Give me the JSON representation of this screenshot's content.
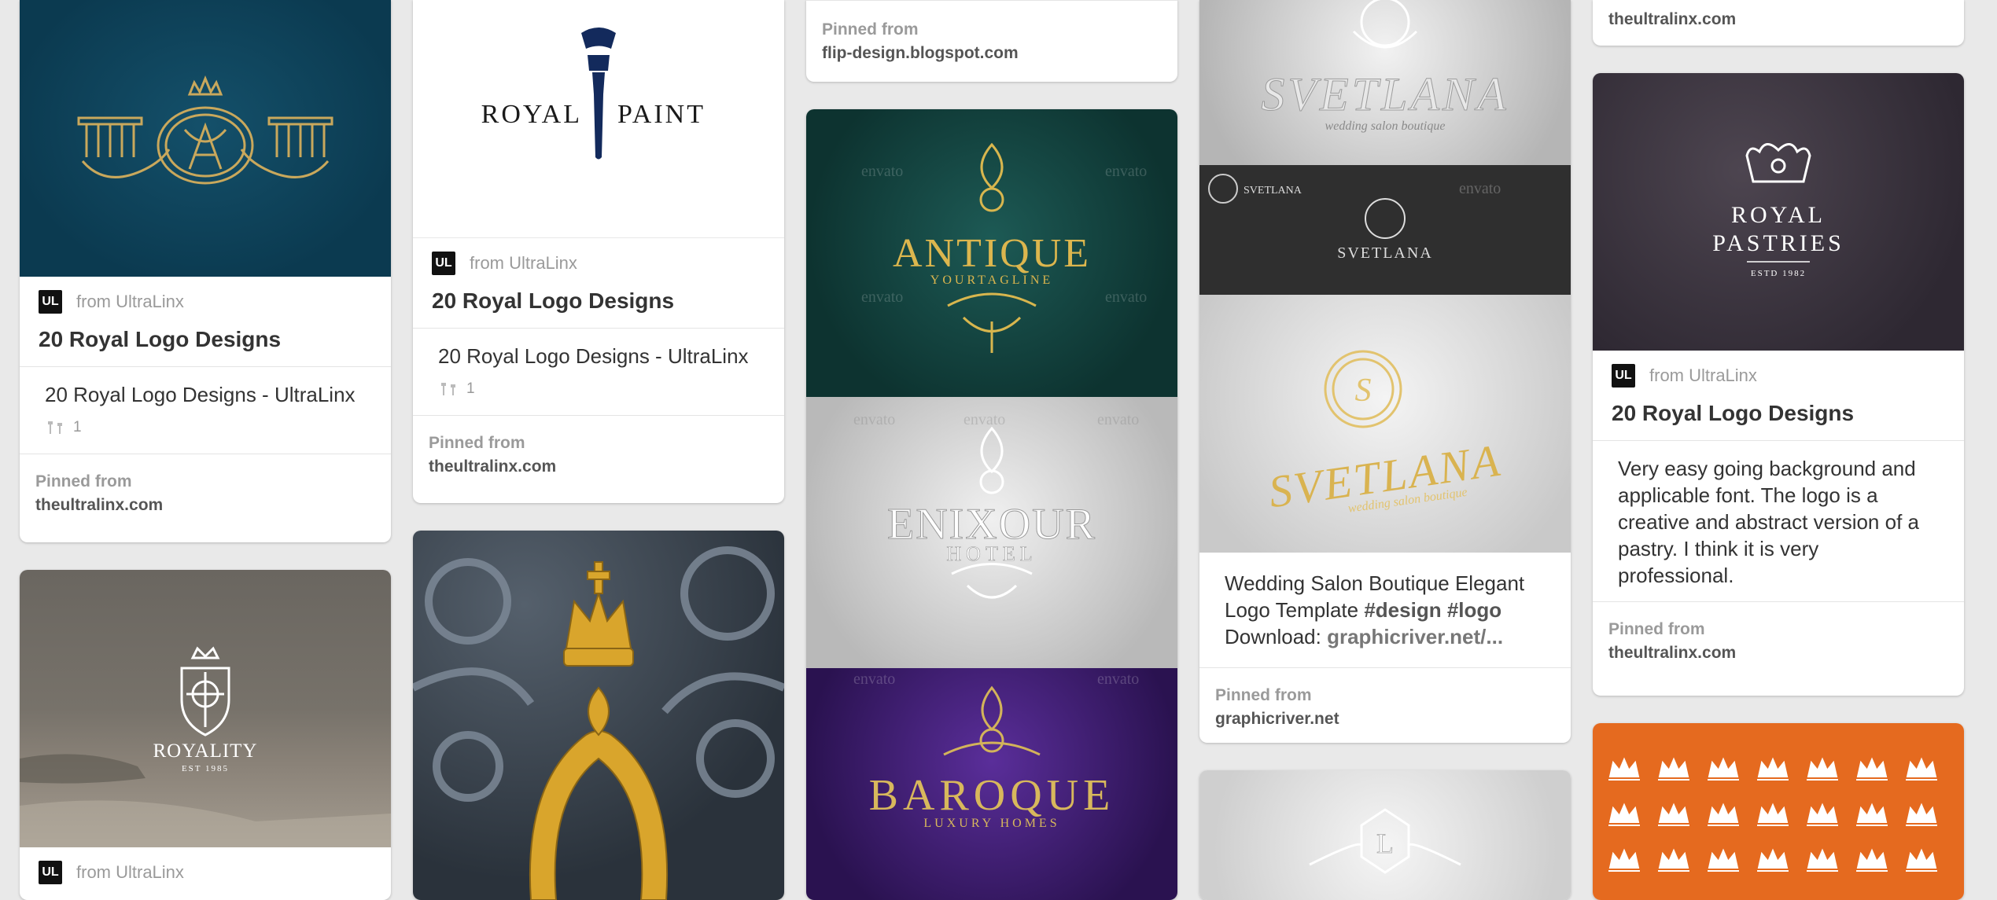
{
  "pins": {
    "c1p1": {
      "from": "from UltraLinx",
      "badge": "UL",
      "title": "20 Royal Logo Designs",
      "desc": "20 Royal Logo Designs - UltraLinx",
      "repins": "1",
      "pinned_label": "Pinned from",
      "source": "theultralinx.com"
    },
    "c1p2": {
      "from": "from UltraLinx",
      "badge": "UL",
      "logo_text": "ROYALITY",
      "logo_sub": "EST 1985"
    },
    "c2p1": {
      "from": "from UltraLinx",
      "badge": "UL",
      "title": "20 Royal Logo Designs",
      "desc": "20 Royal Logo Designs - UltraLinx",
      "repins": "1",
      "pinned_label": "Pinned from",
      "source": "theultralinx.com",
      "logo_left": "ROYAL",
      "logo_right": "PAINT"
    },
    "c3p1": {
      "pinned_label": "Pinned from",
      "source": "flip-design.blogspot.com"
    },
    "c3p2": {
      "antique": "ANTIQUE",
      "antique_sub": "YOURTAGLINE",
      "enixour": "ENIXOUR",
      "enixour_sub": "HOTEL",
      "baroque": "BAROQUE",
      "baroque_sub": "LUXURY HOMES",
      "watermark": "envato"
    },
    "c4p1": {
      "svetlana": "SVETLANA",
      "svetlana_sub": "wedding salon boutique",
      "desc_text": "Wedding Salon Boutique Elegant Logo Template",
      "hash1": "#design",
      "hash2": "#logo",
      "download_label": "Download:",
      "download_link": "graphicriver.net/...",
      "pinned_label": "Pinned from",
      "source": "graphicriver.net",
      "watermark": "envato"
    },
    "c5p0": {
      "source": "theultralinx.com"
    },
    "c5p1": {
      "from": "from UltraLinx",
      "badge": "UL",
      "title": "20 Royal Logo Designs",
      "desc": "Very easy going background and applicable font. The logo is a creative and abstract version of a pastry. I think it is very professional.",
      "pinned_label": "Pinned from",
      "source": "theultralinx.com",
      "logo_l1": "ROYAL",
      "logo_l2": "PASTRIES",
      "logo_sub": "ESTD 1982"
    }
  }
}
